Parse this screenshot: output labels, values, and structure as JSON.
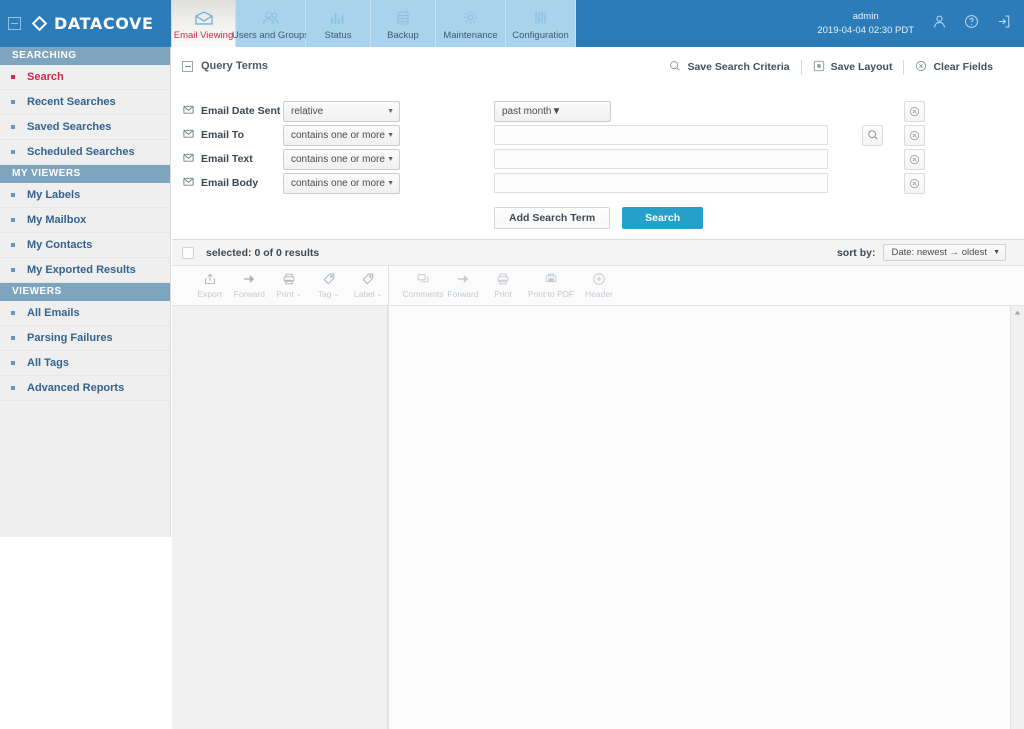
{
  "header": {
    "brand": "DATACOVE",
    "collapse_icon": "collapse-icon",
    "logo_icon": "diamond-logo-icon",
    "tabs": [
      {
        "label": "Email Viewing",
        "icon": "envelope-icon",
        "active": true
      },
      {
        "label": "Users and Groups",
        "icon": "users-icon",
        "active": false
      },
      {
        "label": "Status",
        "icon": "bar-chart-icon",
        "active": false
      },
      {
        "label": "Backup",
        "icon": "database-icon",
        "active": false
      },
      {
        "label": "Maintenance",
        "icon": "gear-icon",
        "active": false
      },
      {
        "label": "Configuration",
        "icon": "sliders-icon",
        "active": false
      }
    ],
    "user": "admin",
    "datetime": "2019-04-04 02:30 PDT",
    "icons": [
      "user-icon",
      "help-icon",
      "logout-icon"
    ],
    "bg_color": "#2b7cb9",
    "accent_color": "#cf2a4b"
  },
  "sidebar": {
    "sections": [
      {
        "title": "SEARCHING",
        "items": [
          {
            "label": "Search",
            "active": true
          },
          {
            "label": "Recent Searches",
            "active": false
          },
          {
            "label": "Saved Searches",
            "active": false
          },
          {
            "label": "Scheduled Searches",
            "active": false
          }
        ]
      },
      {
        "title": "MY VIEWERS",
        "items": [
          {
            "label": "My Labels",
            "active": false
          },
          {
            "label": "My Mailbox",
            "active": false
          },
          {
            "label": "My Contacts",
            "active": false
          },
          {
            "label": "My Exported Results",
            "active": false
          }
        ]
      },
      {
        "title": "VIEWERS",
        "items": [
          {
            "label": "All Emails",
            "active": false
          },
          {
            "label": "Parsing Failures",
            "active": false
          },
          {
            "label": "All Tags",
            "active": false
          },
          {
            "label": "Advanced Reports",
            "active": false
          }
        ]
      }
    ]
  },
  "query_panel": {
    "title": "Query Terms",
    "collapse_icon": "minus-box-icon",
    "actions": [
      {
        "label": "Save Search Criteria",
        "icon": "save-search-icon"
      },
      {
        "label": "Save Layout",
        "icon": "save-layout-icon"
      },
      {
        "label": "Clear Fields",
        "icon": "clear-fields-icon"
      }
    ],
    "rows": [
      {
        "label": "Email Date Sent",
        "checkbox_icon": "checked-envelope-icon",
        "operator": "relative",
        "second_select": "past month",
        "value": "",
        "has_second_select": true,
        "has_search_btn": false
      },
      {
        "label": "Email To",
        "checkbox_icon": "checked-envelope-icon",
        "operator": "contains one or more of",
        "second_select": "",
        "value": "",
        "has_second_select": false,
        "has_search_btn": true
      },
      {
        "label": "Email Text",
        "checkbox_icon": "checked-envelope-icon",
        "operator": "contains one or more of",
        "second_select": "",
        "value": "",
        "has_second_select": false,
        "has_search_btn": false
      },
      {
        "label": "Email Body",
        "checkbox_icon": "checked-envelope-icon",
        "operator": "contains one or more of",
        "second_select": "",
        "value": "",
        "has_second_select": false,
        "has_search_btn": false
      }
    ],
    "add_term_label": "Add Search Term",
    "search_label": "Search",
    "search_btn_color": "#25a0cb"
  },
  "results": {
    "selected_text": "selected: 0 of 0 results",
    "sort_label": "sort by:",
    "sort_value": "Date: newest → oldest",
    "toolbar_primary": [
      {
        "label": "Export",
        "icon": "export-icon",
        "caret": false
      },
      {
        "label": "Forward",
        "icon": "forward-arrow-icon",
        "caret": false
      },
      {
        "label": "Print",
        "icon": "printer-icon",
        "caret": true
      },
      {
        "label": "Tag",
        "icon": "tag-icon",
        "caret": true
      },
      {
        "label": "Label",
        "icon": "label-icon",
        "caret": true
      }
    ],
    "toolbar_secondary": [
      {
        "label": "Comments",
        "icon": "comments-icon",
        "caret": false
      },
      {
        "label": "Forward",
        "icon": "forward-arrow-icon",
        "caret": false
      },
      {
        "label": "Print",
        "icon": "printer-icon",
        "caret": false
      },
      {
        "label": "Print to PDF",
        "icon": "print-pdf-icon",
        "caret": false
      },
      {
        "label": "Header",
        "icon": "header-magnifier-icon",
        "caret": false
      }
    ],
    "scrollbar_icon": "scroll-up-arrow-icon"
  }
}
